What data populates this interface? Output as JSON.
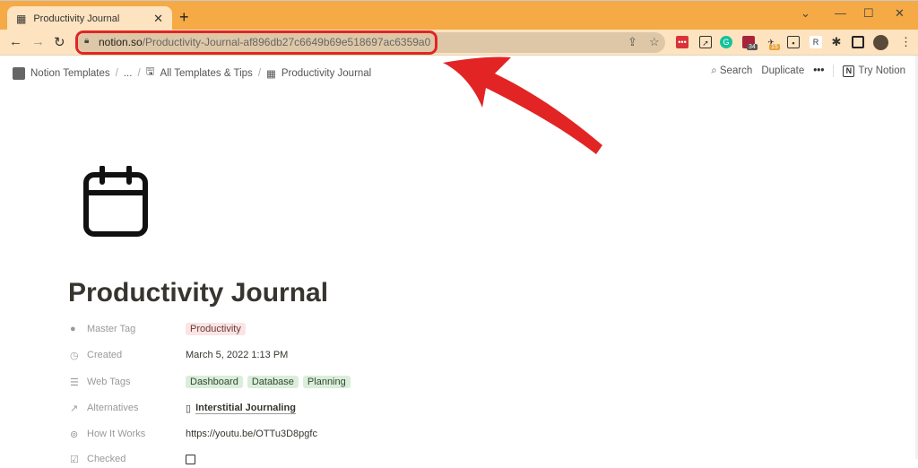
{
  "browser": {
    "tab_title": "Productivity Journal",
    "url_domain": "notion.so",
    "url_path": "/Productivity-Journal-af896db27c6649b69e518697ac6359a0",
    "extension_badges": [
      "34",
      "15"
    ],
    "accent": "#f5aa45"
  },
  "breadcrumb": {
    "items": [
      "Notion Templates",
      "...",
      "All Templates & Tips",
      "Productivity Journal"
    ]
  },
  "header_actions": {
    "search": "Search",
    "duplicate": "Duplicate",
    "more": "•••",
    "try": "Try Notion"
  },
  "page": {
    "icon": "calendar-icon",
    "title": "Productivity Journal",
    "properties": [
      {
        "name": "Master Tag",
        "icon": "tag-icon",
        "tags": [
          "Productivity"
        ],
        "tag_color": "red"
      },
      {
        "name": "Created",
        "icon": "clock-icon",
        "value": "March 5, 2022 1:13 PM"
      },
      {
        "name": "Web Tags",
        "icon": "list-icon",
        "tags": [
          "Dashboard",
          "Database",
          "Planning"
        ],
        "tag_color": "green"
      },
      {
        "name": "Alternatives",
        "icon": "arrow-up-right-icon",
        "value": "Interstitial Journaling"
      },
      {
        "name": "How It Works",
        "icon": "link-icon",
        "value": "https://youtu.be/OTTu3D8pgfc"
      },
      {
        "name": "Checked",
        "icon": "checkbox-icon",
        "checked": false
      }
    ]
  },
  "annotation": {
    "color": "#e22425"
  }
}
